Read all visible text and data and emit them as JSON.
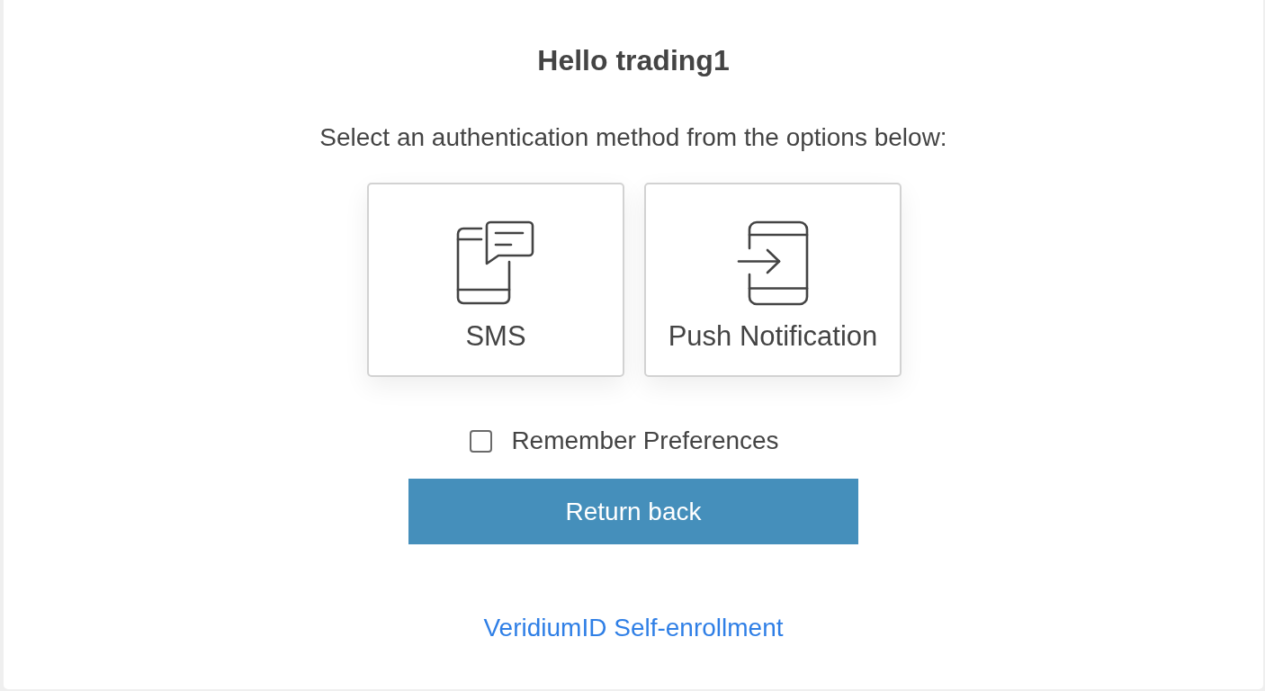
{
  "greeting": {
    "title": "Hello trading1"
  },
  "instruction": "Select an authentication method from the options below:",
  "methods": [
    {
      "kind": "sms",
      "label": "SMS"
    },
    {
      "kind": "push",
      "label": "Push Notification"
    }
  ],
  "remember": {
    "label": "Remember Preferences",
    "checked": false
  },
  "return_button": {
    "label": "Return back"
  },
  "enrollment_link": {
    "label": "VeridiumID Self-enrollment"
  }
}
